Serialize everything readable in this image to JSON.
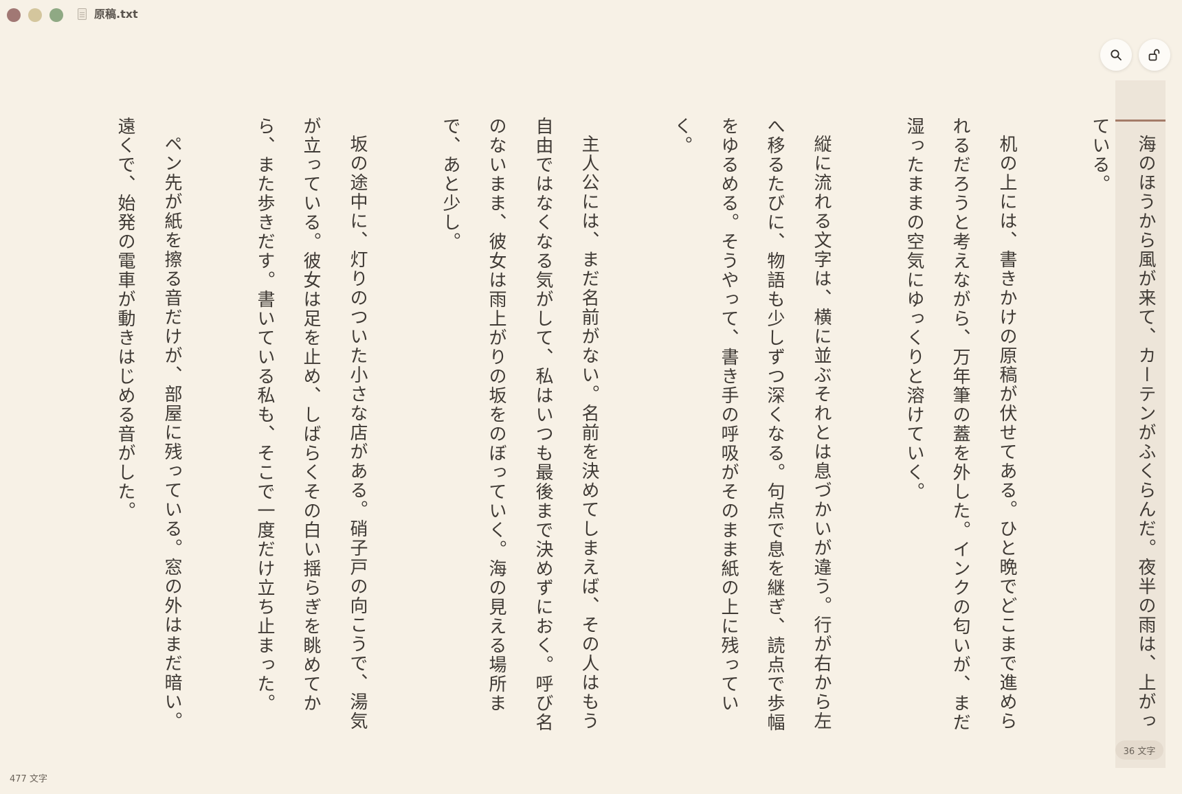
{
  "window": {
    "file_name": "原稿.txt"
  },
  "toolbar": {
    "search_icon": "search-icon",
    "lock_icon": "unlock-icon"
  },
  "editor": {
    "columns": [
      "海のほうから風が来て、カーテンがふくらんだ。夜半の雨は、上がっ",
      "ている。",
      "",
      "机の上には、書きかけの原稿が伏せてある。ひと晩でどこまで進めら",
      "れるだろうと考えながら、万年筆の蓋を外した。インクの匂いが、まだ",
      "湿ったままの空気にゆっくりと溶けていく。",
      "",
      "縦に流れる文字は、横に並ぶそれとは息づかいが違う。行が右から左",
      "へ移るたびに、物語も少しずつ深くなる。句点で息を継ぎ、読点で歩幅",
      "をゆるめる。そうやって、書き手の呼吸がそのまま紙の上に残ってい",
      "く。",
      "",
      "主人公には、まだ名前がない。名前を決めてしまえば、その人はもう",
      "自由ではなくなる気がして、私はいつも最後まで決めずにおく。呼び名",
      "のないまま、彼女は雨上がりの坂をのぼっていく。海の見える場所ま",
      "で、あと少し。",
      "",
      "坂の途中に、灯りのついた小さな店がある。硝子戸の向こうで、湯気",
      "が立っている。彼女は足を止め、しばらくその白い揺らぎを眺めてか",
      "ら、また歩きだす。書いている私も、そこで一度だけ立ち止まった。",
      "",
      "ペン先が紙を擦る音だけが、部屋に残っている。窓の外はまだ暗い。",
      "遠くで、始発の電車が動きはじめる音がした。"
    ],
    "active_column_count": "36 文字"
  },
  "status": {
    "total_count": "477 文字"
  },
  "colors": {
    "background": "#f7f1e6",
    "active_column": "#ede5d9",
    "accent": "#a47b68",
    "text": "#3f3a35"
  }
}
